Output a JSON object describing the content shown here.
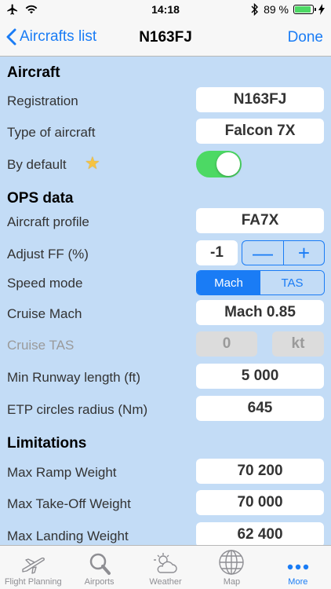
{
  "status_bar": {
    "time": "14:18",
    "battery_percent": "89 %",
    "battery_level": 0.89
  },
  "navbar": {
    "back_label": "Aircrafts list",
    "title": "N163FJ",
    "done_label": "Done"
  },
  "sections": {
    "aircraft": {
      "title": "Aircraft",
      "registration_label": "Registration",
      "registration_value": "N163FJ",
      "type_label": "Type of aircraft",
      "type_value": "Falcon 7X",
      "default_label": "By default",
      "default_on": true
    },
    "ops": {
      "title": "OPS data",
      "profile_label": "Aircraft profile",
      "profile_value": "FA7X",
      "adjust_label": "Adjust FF (%)",
      "adjust_value": "-1",
      "minus_symbol": "—",
      "plus_symbol": "+",
      "speed_label": "Speed mode",
      "speed_options": [
        "Mach",
        "TAS"
      ],
      "speed_selected": "Mach",
      "cruise_mach_label": "Cruise Mach",
      "cruise_mach_value": "Mach 0.85",
      "cruise_tas_label": "Cruise TAS",
      "cruise_tas_value": "0",
      "cruise_tas_unit": "kt",
      "runway_label": "Min Runway length (ft)",
      "runway_value": "5 000",
      "etp_label": "ETP circles radius (Nm)",
      "etp_value": "645"
    },
    "limitations": {
      "title": "Limitations",
      "ramp_label": "Max Ramp Weight",
      "ramp_value": "70 200",
      "takeoff_label": "Max Take-Off Weight",
      "takeoff_value": "70 000",
      "landing_label": "Max Landing Weight",
      "landing_value": "62 400"
    }
  },
  "tabbar": [
    {
      "label": "Flight Planning",
      "icon": "airplane-icon"
    },
    {
      "label": "Airports",
      "icon": "search-icon"
    },
    {
      "label": "Weather",
      "icon": "weather-icon"
    },
    {
      "label": "Map",
      "icon": "globe-icon"
    },
    {
      "label": "More",
      "icon": "more-icon",
      "active": true
    }
  ],
  "colors": {
    "accent": "#1a7cf5",
    "background": "#c3dcf6",
    "toggle_on": "#4cd964"
  }
}
